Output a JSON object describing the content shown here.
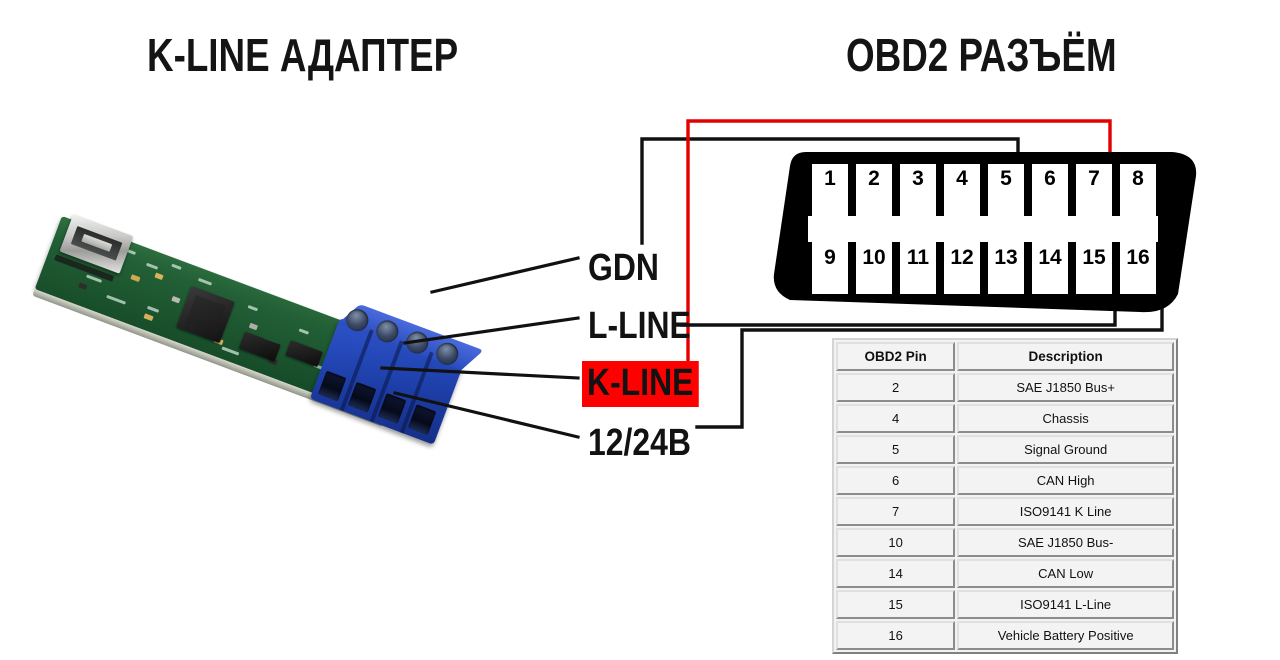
{
  "headings": {
    "left": "K-LINE АДАПТЕР",
    "right": "OBD2 РАЗЪЁМ"
  },
  "adapter_labels": [
    {
      "id": "gdn",
      "text": "GDN",
      "highlight": false,
      "wire_color": "#111111",
      "connects_to_pin": "5"
    },
    {
      "id": "lline",
      "text": "L-LINE",
      "highlight": false,
      "wire_color": "#111111",
      "connects_to_pin": "15"
    },
    {
      "id": "kline",
      "text": "K-LINE",
      "highlight": true,
      "wire_color": "#E40000",
      "connects_to_pin": "7"
    },
    {
      "id": "v1224",
      "text": "12/24B",
      "highlight": false,
      "wire_color": "#111111",
      "connects_to_pin": "16"
    }
  ],
  "obd2_connector": {
    "top_row": [
      "1",
      "2",
      "3",
      "4",
      "5",
      "6",
      "7",
      "8"
    ],
    "bottom_row": [
      "9",
      "10",
      "11",
      "12",
      "13",
      "14",
      "15",
      "16"
    ],
    "body_color": "#000000",
    "pin_color": "#ffffff"
  },
  "pin_table": {
    "headers": [
      "OBD2 Pin",
      "Description"
    ],
    "rows": [
      [
        "2",
        "SAE J1850 Bus+"
      ],
      [
        "4",
        "Chassis"
      ],
      [
        "5",
        "Signal Ground"
      ],
      [
        "6",
        "CAN High"
      ],
      [
        "7",
        "ISO9141 K Line"
      ],
      [
        "10",
        "SAE J1850 Bus-"
      ],
      [
        "14",
        "CAN Low"
      ],
      [
        "15",
        "ISO9141 L-Line"
      ],
      [
        "16",
        "Vehicle Battery Positive"
      ]
    ]
  },
  "colors": {
    "highlight_red": "#FF0000",
    "wire_red": "#E40000",
    "wire_black": "#111111",
    "background": "#FFFFFF"
  }
}
